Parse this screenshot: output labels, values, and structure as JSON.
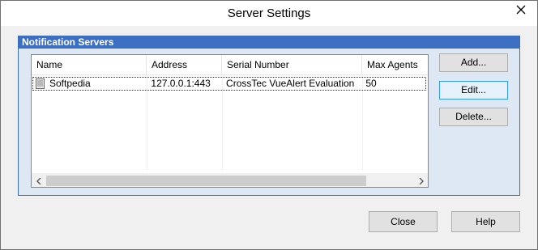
{
  "window": {
    "title": "Server Settings"
  },
  "group": {
    "header": "Notification Servers"
  },
  "listview": {
    "columns": [
      "Name",
      "Address",
      "Serial Number",
      "Max Agents"
    ],
    "rows": [
      {
        "name": "Softpedia",
        "address": "127.0.0.1:443",
        "serial": "CrossTec VueAlert Evaluation",
        "max_agents": "50"
      }
    ]
  },
  "buttons": {
    "add": "Add...",
    "edit": "Edit...",
    "delete": "Delete...",
    "close": "Close",
    "help": "Help"
  },
  "colors": {
    "group_header": "#3a6fc4",
    "group_background": "#dde8f4",
    "window_background": "#f0f0f0"
  }
}
